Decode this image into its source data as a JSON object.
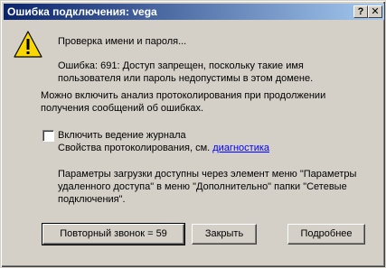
{
  "window": {
    "title": "Ошибка подключения: vega",
    "help_glyph": "?",
    "close_glyph": "✕"
  },
  "status": {
    "checking": "Проверка имени и пароля...",
    "error_line1": "Ошибка: 691: Доступ запрещен, поскольку такие имя",
    "error_line2": "пользователя или пароль недопустимы в этом домене."
  },
  "logging_info": {
    "line1": "Можно включить анализ протоколирования при продолжении",
    "line2": "получения сообщений об ошибках."
  },
  "logging": {
    "checkbox_label": "Включить ведение журнала",
    "checked": false,
    "properties_text": "Свойства протоколирования, см.",
    "link_text": "диагностика"
  },
  "params_info": {
    "line1": "Параметры загрузки доступны через элемент меню \"Параметры",
    "line2": "удаленного доступа\" в меню \"Дополнительно\" папки \"Сетевые",
    "line3": "подключения\"."
  },
  "buttons": {
    "redial": "Повторный звонок = 59",
    "close": "Закрыть",
    "more": "Подробнее"
  },
  "icons": {
    "warning": "warning-icon",
    "warning_color": "#f8d800"
  }
}
